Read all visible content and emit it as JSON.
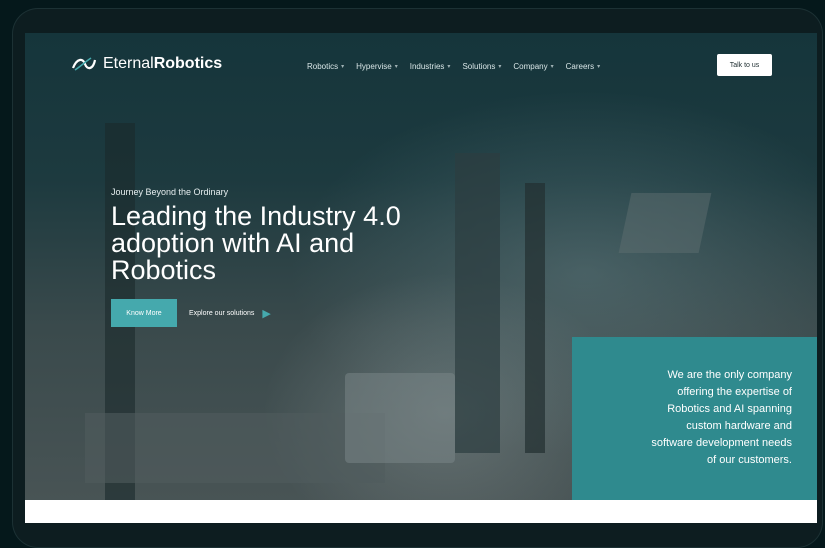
{
  "header": {
    "logo": {
      "prefix": "Eternal",
      "suffix": "Robotics"
    },
    "menu": [
      {
        "label": "Robotics"
      },
      {
        "label": "Hypervise"
      },
      {
        "label": "Industries"
      },
      {
        "label": "Solutions"
      },
      {
        "label": "Company"
      },
      {
        "label": "Careers"
      }
    ],
    "cta_label": "Talk to us"
  },
  "hero": {
    "kicker": "Journey Beyond the Ordinary",
    "title_lines": [
      "Leading the Industry 4.0",
      "adoption with AI and",
      "Robotics"
    ],
    "primary_label": "Know More",
    "secondary_label": "Explore our solutions"
  },
  "info": {
    "text_lines": [
      "We are the only company",
      "offering the expertise of",
      "Robotics and AI spanning",
      "custom hardware and",
      "software development needs",
      "of our customers."
    ]
  },
  "icons": {
    "logo": "infinity-logo-icon",
    "play": "play-icon",
    "chevron": "chevron-down-icon"
  },
  "colors": {
    "accent": "#45a9ad",
    "card": "#2f8a8e",
    "bg": "#05181b"
  }
}
